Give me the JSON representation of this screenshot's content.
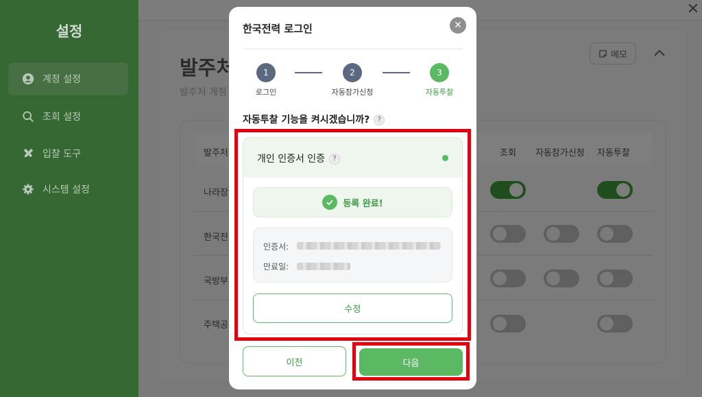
{
  "sidebar": {
    "title": "설정",
    "items": [
      {
        "label": "계정 설정",
        "icon": "user-circle-icon",
        "active": true
      },
      {
        "label": "조회 설정",
        "icon": "search-icon",
        "active": false
      },
      {
        "label": "입찰 도구",
        "icon": "tools-icon",
        "active": false
      },
      {
        "label": "시스템 설정",
        "icon": "gear-icon",
        "active": false
      }
    ]
  },
  "background": {
    "page_title": "발주처",
    "page_subtitle": "발주처 계정",
    "memo_label": "메모",
    "table": {
      "headers": [
        "발주처",
        "조회",
        "자동참가신청",
        "자동투찰"
      ],
      "rows": [
        {
          "label": "나라장",
          "toggles": [
            true,
            null,
            true
          ]
        },
        {
          "label": "한국전",
          "toggles": [
            false,
            false,
            false
          ]
        },
        {
          "label": "국방부",
          "toggles": [
            false,
            false,
            false
          ]
        },
        {
          "label": "주택공",
          "toggles": [
            false,
            null,
            false
          ]
        }
      ]
    }
  },
  "modal": {
    "title": "한국전력 로그인",
    "steps": [
      {
        "number": "1",
        "label": "로그인",
        "state": "done"
      },
      {
        "number": "2",
        "label": "자동참가신청",
        "state": "done"
      },
      {
        "number": "3",
        "label": "자동투찰",
        "state": "current"
      }
    ],
    "question": "자동투찰 기능을 켜시겠습니까?",
    "help_mark": "?",
    "cert": {
      "title": "개인 인증서 인증",
      "status": "등록 완료!",
      "cert_label": "인증서:",
      "expiry_label": "만료일:",
      "edit_label": "수정"
    },
    "prev_label": "이전",
    "next_label": "다음"
  },
  "colors": {
    "accent": "#5bb863",
    "accent_text": "#3c9a44",
    "highlight": "#e3000f",
    "sidebar": "#356832",
    "step_done": "#5b6980"
  }
}
